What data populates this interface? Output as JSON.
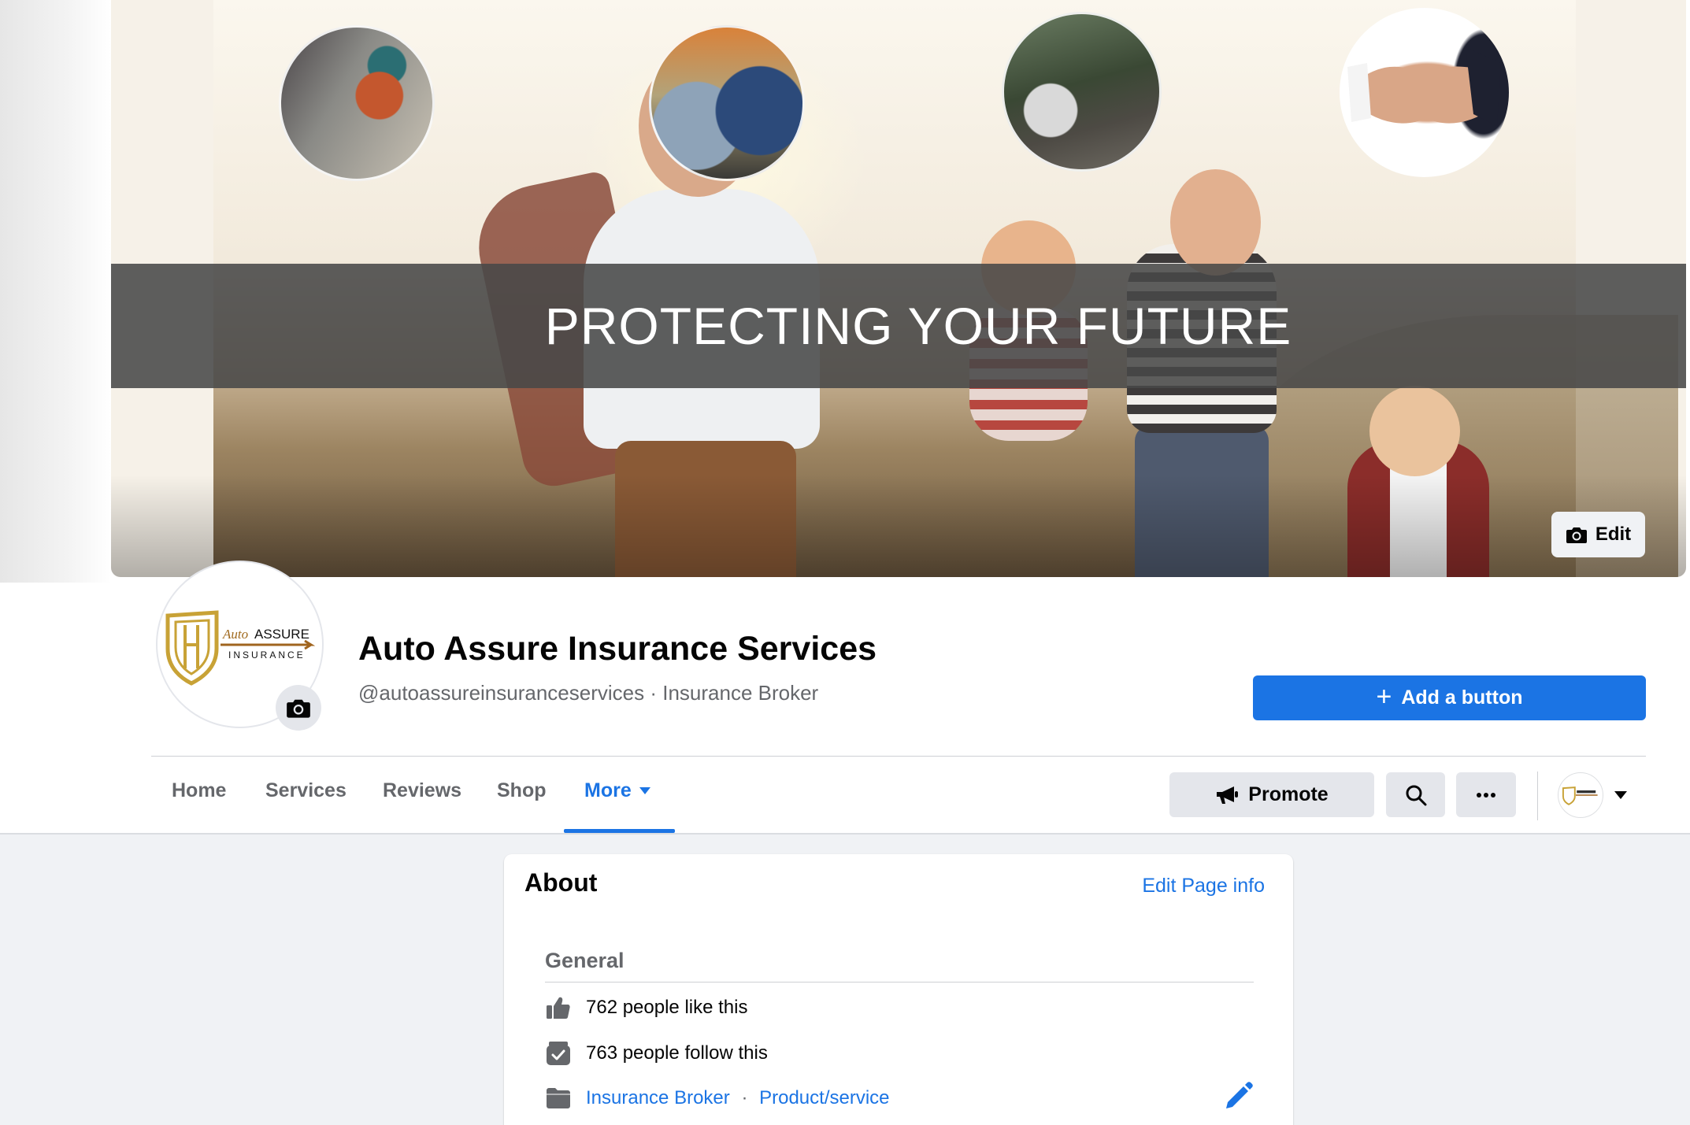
{
  "cover": {
    "banner_text": "PROTECTING YOUR FUTURE",
    "edit_label": "Edit",
    "edit_icon": "camera-icon"
  },
  "profile": {
    "logo_text_script": "Auto",
    "logo_text_main": "ASSURE",
    "logo_text_sub": "INSURANCE",
    "camera_icon": "camera-icon",
    "page_name": "Auto Assure Insurance Services",
    "handle_line": "@autoassureinsuranceservices · Insurance Broker",
    "add_button_label": "Add a button"
  },
  "tabs": {
    "items": [
      {
        "label": "Home"
      },
      {
        "label": "Services"
      },
      {
        "label": "Reviews"
      },
      {
        "label": "Shop"
      },
      {
        "label": "More"
      }
    ],
    "active": "More"
  },
  "actions": {
    "promote_label": "Promote",
    "promote_icon": "megaphone-icon",
    "search_icon": "search-icon",
    "more_label": "···",
    "account_caret_icon": "caret-down-icon"
  },
  "about": {
    "title": "About",
    "edit_link": "Edit Page info",
    "general_label": "General",
    "likes_text": "762 people like this",
    "follows_text": "763 people follow this",
    "category_1": "Insurance Broker",
    "category_sep": "·",
    "category_2": "Product/service"
  },
  "colors": {
    "accent": "#1b74e4",
    "text_primary": "#050505",
    "text_secondary": "#65676b",
    "button_grey": "#e4e6eb",
    "page_bg": "#f0f2f5"
  }
}
